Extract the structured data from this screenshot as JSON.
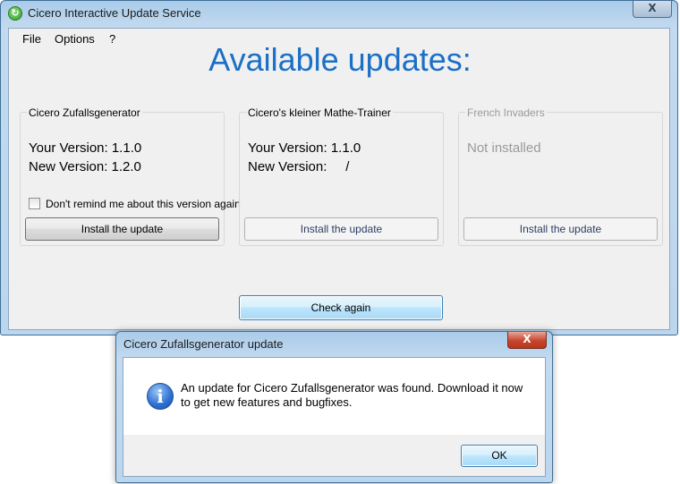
{
  "window": {
    "title": "Cicero Interactive Update Service",
    "close_glyph": "X",
    "icon": "refresh-icon"
  },
  "menu": [
    "File",
    "Options",
    "?"
  ],
  "heading": "Available updates:",
  "groups": [
    {
      "title": "Cicero Zufallsgenerator",
      "your_version": "Your Version: 1.1.0",
      "new_version": "New Version: 1.2.0",
      "checkbox_label": "Don't remind me about this version again",
      "button": "Install the update",
      "enabled": true
    },
    {
      "title": "Cicero's kleiner Mathe-Trainer",
      "your_version": "Your Version: 1.1.0",
      "new_version": "New Version:     /",
      "button": "Install the update",
      "enabled": false
    },
    {
      "title": "French Invaders",
      "status": "Not installed",
      "button": "Install the update",
      "enabled": false
    }
  ],
  "check_again": "Check again",
  "dialog": {
    "title": "Cicero Zufallsgenerator update",
    "close_glyph": "X",
    "icon": "info-icon",
    "icon_glyph": "i",
    "message": "An update for Cicero Zufallsgenerator was found. Download it now to get new features and bugfixes.",
    "ok": "OK"
  },
  "colors": {
    "heading": "#1a6fc6",
    "disabled_text": "#9a9a9a",
    "dialog_close": "#c7452d"
  }
}
